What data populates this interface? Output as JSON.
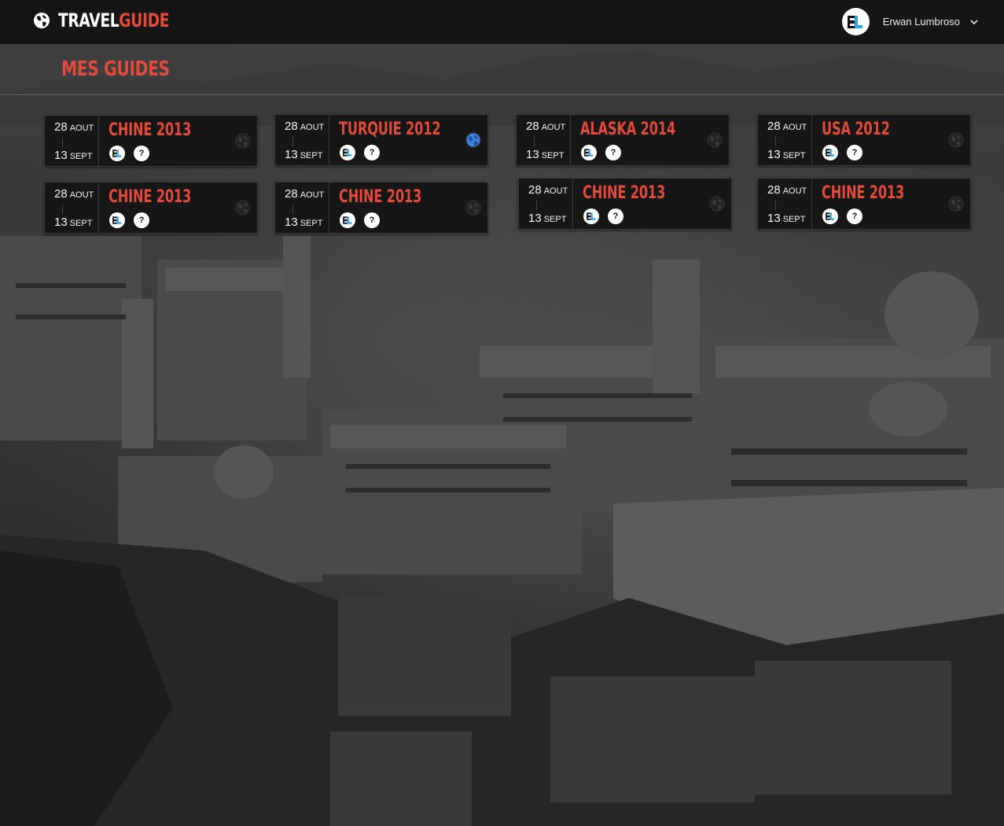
{
  "brand": {
    "part1": "TRAVEL",
    "part2": "GUIDE"
  },
  "user": {
    "name": "Erwan Lumbroso",
    "avatar_initials": "EL"
  },
  "page": {
    "title": "MES GUIDES"
  },
  "colors": {
    "accent": "#e24a3b",
    "topbar": "#151515",
    "card": "#161616",
    "active_globe": "#3b82e0"
  },
  "guides": [
    {
      "title": "CHINE 2013",
      "start_day": "28",
      "start_month": "AOUT",
      "end_day": "13",
      "end_month": "SEPT",
      "member": "EL",
      "extra": "?",
      "globe_active": false
    },
    {
      "title": "TURQUIE 2012",
      "start_day": "28",
      "start_month": "AOUT",
      "end_day": "13",
      "end_month": "SEPT",
      "member": "EL",
      "extra": "?",
      "globe_active": true
    },
    {
      "title": "ALASKA 2014",
      "start_day": "28",
      "start_month": "AOUT",
      "end_day": "13",
      "end_month": "SEPT",
      "member": "EL",
      "extra": "?",
      "globe_active": false
    },
    {
      "title": "USA 2012",
      "start_day": "28",
      "start_month": "AOUT",
      "end_day": "13",
      "end_month": "SEPT",
      "member": "EL",
      "extra": "?",
      "globe_active": false
    },
    {
      "title": "CHINE 2013",
      "start_day": "28",
      "start_month": "AOUT",
      "end_day": "13",
      "end_month": "SEPT",
      "member": "EL",
      "extra": "?",
      "globe_active": false
    },
    {
      "title": "CHINE 2013",
      "start_day": "28",
      "start_month": "AOUT",
      "end_day": "13",
      "end_month": "SEPT",
      "member": "EL",
      "extra": "?",
      "globe_active": false
    },
    {
      "title": "CHINE 2013",
      "start_day": "28",
      "start_month": "AOUT",
      "end_day": "13",
      "end_month": "SEPT",
      "member": "EL",
      "extra": "?",
      "globe_active": false
    },
    {
      "title": "CHINE 2013",
      "start_day": "28",
      "start_month": "AOUT",
      "end_day": "13",
      "end_month": "SEPT",
      "member": "EL",
      "extra": "?",
      "globe_active": false
    }
  ]
}
